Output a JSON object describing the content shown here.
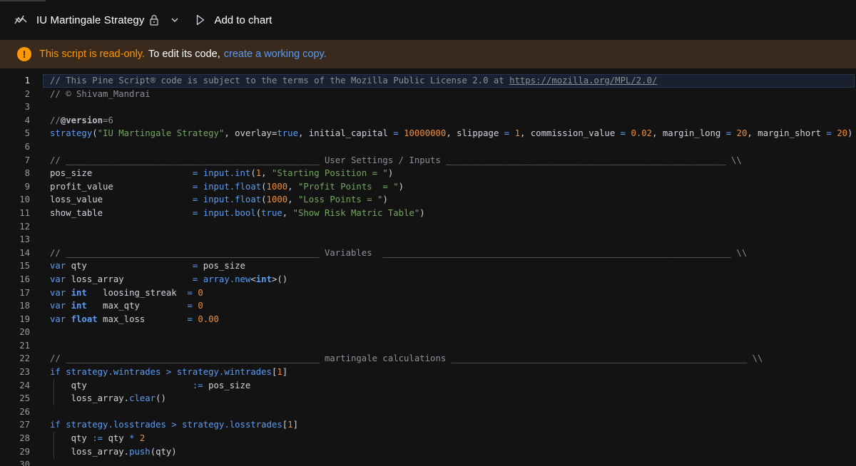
{
  "toolbar": {
    "title": "IU Martingale Strategy",
    "add_to_chart": "Add to chart",
    "icons": [
      "pine-logo-icon",
      "lock-icon",
      "chevron-down-icon",
      "play-icon"
    ]
  },
  "banner": {
    "strong": "This script is read-only.",
    "text": "To edit its code,",
    "link": "create a working copy.",
    "accent": "#ff9800",
    "link_color": "#5b9cf6"
  },
  "editor": {
    "colors": {
      "comment": "#8a8f98",
      "keyword": "#5b9cf6",
      "string": "#73a85f",
      "number": "#f28c38",
      "plain": "#d1d4dc",
      "background": "#131313"
    },
    "highlighted_line": 1,
    "lines": [
      {
        "n": "1",
        "t": [
          [
            "c",
            "// This Pine Script® code is subject to the terms of the Mozilla Public License 2.0 at "
          ],
          [
            "u",
            "https://mozilla.org/MPL/2.0/"
          ]
        ]
      },
      {
        "n": "2",
        "t": [
          [
            "c",
            "// © Shivam_Mandrai"
          ]
        ]
      },
      {
        "n": "3",
        "t": []
      },
      {
        "n": "4",
        "t": [
          [
            "c",
            "//"
          ],
          [
            "b",
            "@version"
          ],
          [
            "c",
            "=6"
          ]
        ]
      },
      {
        "n": "5",
        "t": [
          [
            "f",
            "strategy"
          ],
          [
            "p",
            "("
          ],
          [
            "s",
            "\"IU Martingale Strategy\""
          ],
          [
            "p",
            ", overlay="
          ],
          [
            "k",
            "true"
          ],
          [
            "p",
            ", initial_capital "
          ],
          [
            "k",
            "="
          ],
          [
            "p",
            " "
          ],
          [
            "n",
            "10000000"
          ],
          [
            "p",
            ", slippage "
          ],
          [
            "k",
            "="
          ],
          [
            "p",
            " "
          ],
          [
            "n",
            "1"
          ],
          [
            "p",
            ", commission_value "
          ],
          [
            "k",
            "="
          ],
          [
            "p",
            " "
          ],
          [
            "n",
            "0.02"
          ],
          [
            "p",
            ", margin_long "
          ],
          [
            "k",
            "="
          ],
          [
            "p",
            " "
          ],
          [
            "n",
            "20"
          ],
          [
            "p",
            ", margin_short "
          ],
          [
            "k",
            "="
          ],
          [
            "p",
            " "
          ],
          [
            "n",
            "20"
          ],
          [
            "p",
            ")"
          ]
        ]
      },
      {
        "n": "6",
        "t": []
      },
      {
        "n": "7",
        "t": [
          [
            "c",
            "// ________________________________________________ User Settings / Inputs _____________________________________________________ \\\\"
          ]
        ]
      },
      {
        "n": "8",
        "t": [
          [
            "p",
            "pos_size                   "
          ],
          [
            "k",
            "="
          ],
          [
            "p",
            " "
          ],
          [
            "f",
            "input.int"
          ],
          [
            "p",
            "("
          ],
          [
            "n",
            "1"
          ],
          [
            "p",
            ", "
          ],
          [
            "s",
            "\"Starting Position = \""
          ],
          [
            "p",
            ")"
          ]
        ]
      },
      {
        "n": "9",
        "t": [
          [
            "p",
            "profit_value               "
          ],
          [
            "k",
            "="
          ],
          [
            "p",
            " "
          ],
          [
            "f",
            "input.float"
          ],
          [
            "p",
            "("
          ],
          [
            "n",
            "1000"
          ],
          [
            "p",
            ", "
          ],
          [
            "s",
            "\"Profit Points  = \""
          ],
          [
            "p",
            ")"
          ]
        ]
      },
      {
        "n": "10",
        "t": [
          [
            "p",
            "loss_value                 "
          ],
          [
            "k",
            "="
          ],
          [
            "p",
            " "
          ],
          [
            "f",
            "input.float"
          ],
          [
            "p",
            "("
          ],
          [
            "n",
            "1000"
          ],
          [
            "p",
            ", "
          ],
          [
            "s",
            "\"Loss Points = \""
          ],
          [
            "p",
            ")"
          ]
        ]
      },
      {
        "n": "11",
        "t": [
          [
            "p",
            "show_table                 "
          ],
          [
            "k",
            "="
          ],
          [
            "p",
            " "
          ],
          [
            "f",
            "input.bool"
          ],
          [
            "p",
            "("
          ],
          [
            "k",
            "true"
          ],
          [
            "p",
            ", "
          ],
          [
            "s",
            "\"Show Risk Matric Table\""
          ],
          [
            "p",
            ")"
          ]
        ]
      },
      {
        "n": "12",
        "t": []
      },
      {
        "n": "13",
        "t": []
      },
      {
        "n": "14",
        "t": [
          [
            "c",
            "// ________________________________________________ Variables  __________________________________________________________________ \\\\"
          ]
        ]
      },
      {
        "n": "15",
        "t": [
          [
            "k",
            "var"
          ],
          [
            "p",
            " qty                    "
          ],
          [
            "k",
            "="
          ],
          [
            "p",
            " pos_size"
          ]
        ]
      },
      {
        "n": "16",
        "t": [
          [
            "k",
            "var"
          ],
          [
            "p",
            " loss_array             "
          ],
          [
            "k",
            "="
          ],
          [
            "p",
            " "
          ],
          [
            "f",
            "array.new"
          ],
          [
            "p",
            "<"
          ],
          [
            "kb",
            "int"
          ],
          [
            "p",
            ">()"
          ]
        ]
      },
      {
        "n": "17",
        "t": [
          [
            "k",
            "var"
          ],
          [
            "p",
            " "
          ],
          [
            "kb",
            "int"
          ],
          [
            "p",
            "   loosing_streak  "
          ],
          [
            "k",
            "="
          ],
          [
            "p",
            " "
          ],
          [
            "n",
            "0"
          ]
        ]
      },
      {
        "n": "18",
        "t": [
          [
            "k",
            "var"
          ],
          [
            "p",
            " "
          ],
          [
            "kb",
            "int"
          ],
          [
            "p",
            "   max_qty         "
          ],
          [
            "k",
            "="
          ],
          [
            "p",
            " "
          ],
          [
            "n",
            "0"
          ]
        ]
      },
      {
        "n": "19",
        "t": [
          [
            "k",
            "var"
          ],
          [
            "p",
            " "
          ],
          [
            "kb",
            "float"
          ],
          [
            "p",
            " max_loss        "
          ],
          [
            "k",
            "="
          ],
          [
            "p",
            " "
          ],
          [
            "n",
            "0.00"
          ]
        ]
      },
      {
        "n": "20",
        "t": []
      },
      {
        "n": "21",
        "t": []
      },
      {
        "n": "22",
        "t": [
          [
            "c",
            "// ________________________________________________ martingale calculations ________________________________________________________ \\\\"
          ]
        ]
      },
      {
        "n": "23",
        "t": [
          [
            "k",
            "if"
          ],
          [
            "p",
            " "
          ],
          [
            "k",
            "strategy.wintrades"
          ],
          [
            "p",
            " "
          ],
          [
            "k",
            ">"
          ],
          [
            "p",
            " "
          ],
          [
            "k",
            "strategy.wintrades"
          ],
          [
            "p",
            "["
          ],
          [
            "n",
            "1"
          ],
          [
            "p",
            "]"
          ]
        ]
      },
      {
        "n": "24",
        "g": true,
        "t": [
          [
            "p",
            "    qty                    "
          ],
          [
            "k",
            ":="
          ],
          [
            "p",
            " pos_size"
          ]
        ]
      },
      {
        "n": "25",
        "g": true,
        "t": [
          [
            "p",
            "    loss_array."
          ],
          [
            "f",
            "clear"
          ],
          [
            "p",
            "()"
          ]
        ]
      },
      {
        "n": "26",
        "t": []
      },
      {
        "n": "27",
        "t": [
          [
            "k",
            "if"
          ],
          [
            "p",
            " "
          ],
          [
            "k",
            "strategy.losstrades"
          ],
          [
            "p",
            " "
          ],
          [
            "k",
            ">"
          ],
          [
            "p",
            " "
          ],
          [
            "k",
            "strategy.losstrades"
          ],
          [
            "p",
            "["
          ],
          [
            "n",
            "1"
          ],
          [
            "p",
            "]"
          ]
        ]
      },
      {
        "n": "28",
        "g": true,
        "t": [
          [
            "p",
            "    qty "
          ],
          [
            "k",
            ":="
          ],
          [
            "p",
            " qty "
          ],
          [
            "k",
            "*"
          ],
          [
            "p",
            " "
          ],
          [
            "n",
            "2"
          ]
        ]
      },
      {
        "n": "29",
        "g": true,
        "t": [
          [
            "p",
            "    loss_array."
          ],
          [
            "f",
            "push"
          ],
          [
            "p",
            "(qty)"
          ]
        ]
      },
      {
        "n": "30",
        "t": []
      }
    ]
  }
}
